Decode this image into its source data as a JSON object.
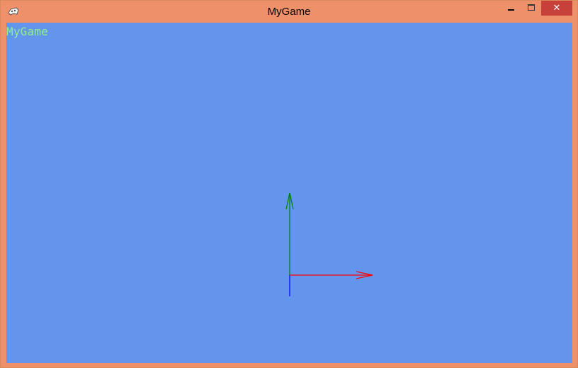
{
  "window": {
    "title": "MyGame",
    "close_glyph": "✕",
    "icons": {
      "app": "gamepad-icon",
      "minimize": "minimize-icon",
      "maximize": "maximize-icon",
      "close": "close-icon"
    },
    "colors": {
      "frame": "#EE916A",
      "close_button": "#C7403A"
    }
  },
  "game": {
    "overlay_text": "MyGame",
    "colors": {
      "background": "#6495ED",
      "overlay_text": "#90EE90",
      "x_axis": "#FF0000",
      "y_axis": "#008000",
      "z_axis": "#0000FF"
    }
  }
}
